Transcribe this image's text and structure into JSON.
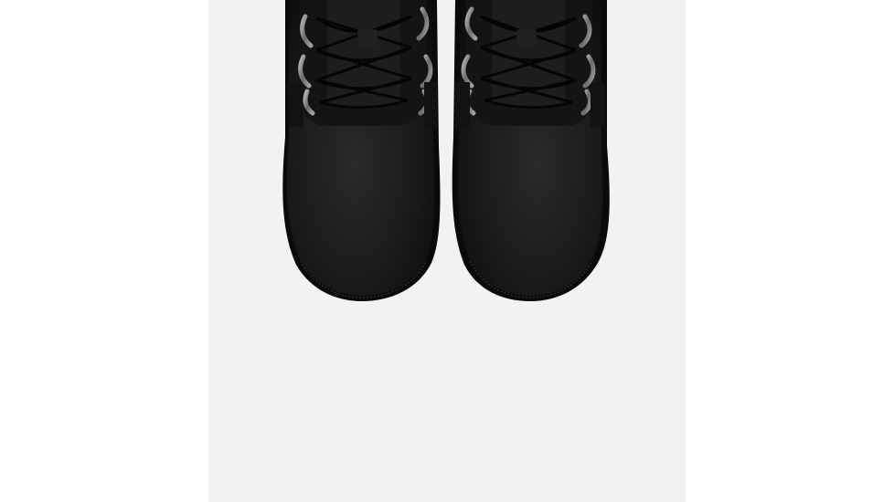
{
  "viewer": {
    "background": "#ffffff"
  },
  "product_image": {
    "alt": "",
    "view": "top-down",
    "subject": "pair-of-black-lace-up-boots",
    "backdrop_color": "#f2f2f2",
    "boot_color": "#151515",
    "hardware_color": "#8d8d8d"
  }
}
